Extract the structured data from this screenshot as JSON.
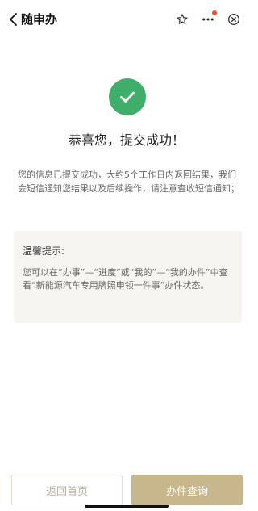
{
  "nav": {
    "title": "随申办",
    "back_icon": "chevron-left-icon",
    "actions": [
      "star-outline-icon",
      "more-dots-icon",
      "close-circle-icon"
    ],
    "badge_color": "#f04e2a"
  },
  "result": {
    "status_icon": "check-circle-icon",
    "status_color": "#3fae6b",
    "title": "恭喜您，提交成功！",
    "description": "您的信息已提交成功，大约5个工作日内返回结果，我们会短信通知您结果以及后续操作，请注意查收短信通知；"
  },
  "tip": {
    "title": "温馨提示:",
    "body": "您可以在“办事”—“进度”或“我的”—“我的办件”中查看“新能源汽车专用牌照申领一件事”办件状态。"
  },
  "actions": {
    "home_label": "返回首页",
    "query_label": "办件查询",
    "primary_color": "#c8b68d"
  }
}
